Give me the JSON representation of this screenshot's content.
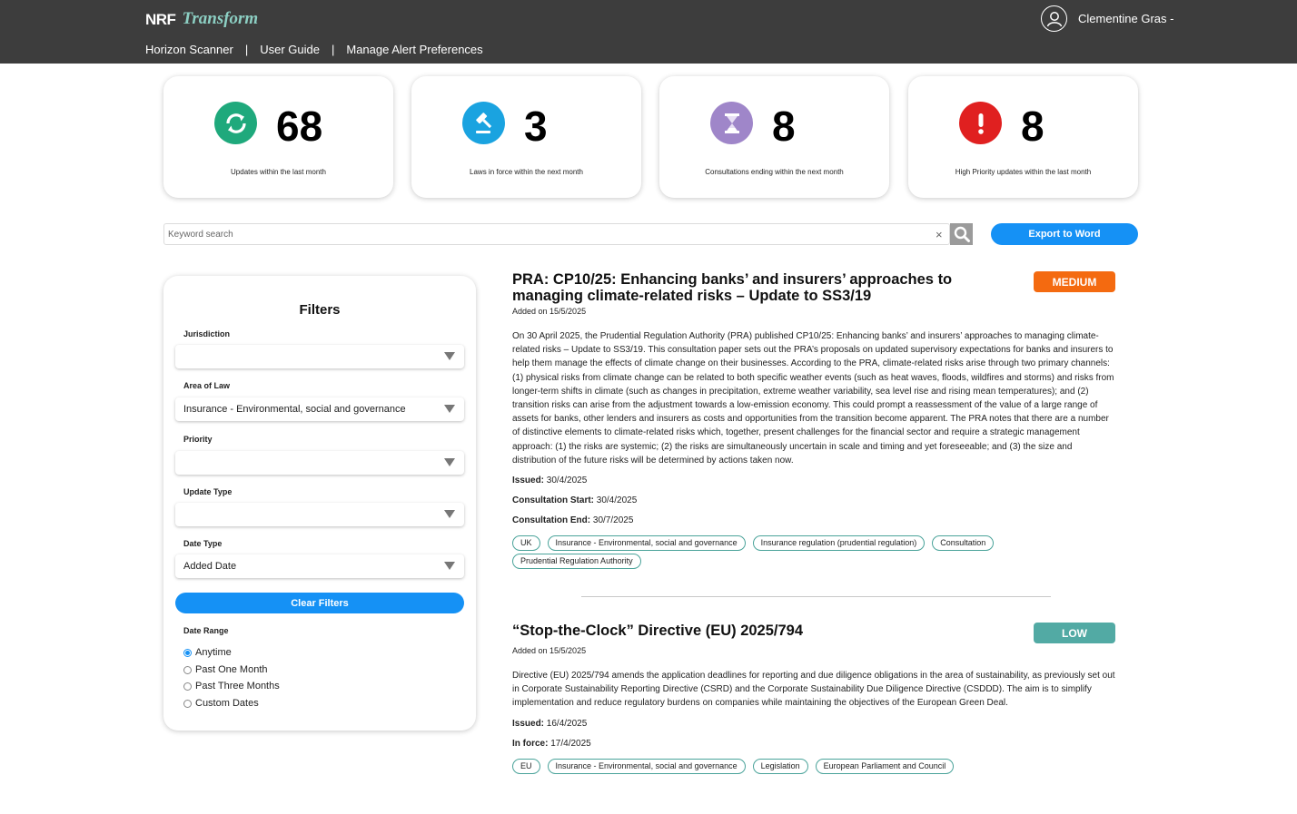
{
  "header": {
    "logo_nrf": "NRF",
    "logo_transform": "Transform",
    "nav": [
      "Horizon Scanner",
      "User Guide",
      "Manage Alert Preferences"
    ],
    "separator": "|",
    "user_name": "Clementine Gras -"
  },
  "stats": [
    {
      "value": "68",
      "caption": "Updates within the last month",
      "color": "#1fa97c",
      "icon": "refresh-icon"
    },
    {
      "value": "3",
      "caption": "Laws in force within the next month",
      "color": "#1aa3e0",
      "icon": "gavel-icon"
    },
    {
      "value": "8",
      "caption": "Consultations ending within the next month",
      "color": "#9f86c9",
      "icon": "hourglass-icon"
    },
    {
      "value": "8",
      "caption": "High Priority updates within the last month",
      "color": "#e02020",
      "icon": "alert-icon"
    }
  ],
  "search": {
    "placeholder": "Keyword search",
    "clear_symbol": "×",
    "export_label": "Export to Word"
  },
  "filters": {
    "title": "Filters",
    "jurisdiction_label": "Jurisdiction",
    "jurisdiction_value": "",
    "area_label": "Area of Law",
    "area_value": "Insurance - Environmental, social and governance",
    "priority_label": "Priority",
    "priority_value": "",
    "update_type_label": "Update Type",
    "update_type_value": "",
    "date_type_label": "Date Type",
    "date_type_value": "Added Date",
    "clear_label": "Clear Filters",
    "date_range_label": "Date Range",
    "date_range_options": [
      "Anytime",
      "Past One Month",
      "Past Three Months",
      "Custom Dates"
    ],
    "date_range_selected": "Anytime"
  },
  "articles": [
    {
      "title": "PRA: CP10/25: Enhancing banks’ and insurers’ approaches to managing climate-related risks – Update to SS3/19",
      "added": "Added on 15/5/2025",
      "priority": "MEDIUM",
      "priority_color": "#f46a10",
      "body": "On 30 April 2025, the Prudential Regulation Authority (PRA) published CP10/25: Enhancing banks’ and insurers’ approaches to managing climate-related risks – Update to SS3/19. This consultation paper sets out the PRA’s proposals on updated supervisory expectations for banks and insurers to help them manage the effects of climate change on their businesses. According to the PRA, climate-related risks arise through two primary channels: (1) physical risks from climate change can be related to both specific weather events (such as heat waves, floods, wildfires and storms) and risks from longer-term shifts in climate (such as changes in precipitation, extreme weather variability, sea level rise and rising mean temperatures); and (2) transition risks can arise from the adjustment towards a low-emission economy. This could prompt a reassessment of the value of a large range of assets for banks, other lenders and insurers as costs and opportunities from the transition become apparent. The PRA notes that there are a number of distinctive elements to climate-related risks which, together, present challenges for the financial sector and require a strategic management approach: (1) the risks are systemic; (2) the risks are simultaneously uncertain in scale and timing and yet foreseeable; and (3) the size and distribution of the future risks will be determined by actions taken now.",
      "meta": [
        {
          "label": "Issued:",
          "value": "30/4/2025"
        },
        {
          "label": "Consultation Start:",
          "value": "30/4/2025"
        },
        {
          "label": "Consultation End:",
          "value": "30/7/2025"
        }
      ],
      "tags": [
        "UK",
        "Insurance - Environmental, social and governance",
        "Insurance regulation (prudential regulation)",
        "Consultation",
        "Prudential Regulation Authority"
      ]
    },
    {
      "title": "“Stop-the-Clock” Directive (EU) 2025/794",
      "added": "Added on 15/5/2025",
      "priority": "LOW",
      "priority_color": "#52aaa4",
      "body": "Directive (EU) 2025/794 amends the application deadlines for reporting and due diligence obligations in the area of sustainability, as previously set out in Corporate Sustainability Reporting Directive (CSRD) and the Corporate Sustainability Due Diligence Directive (CSDDD). The aim is to simplify implementation and reduce regulatory burdens on companies while maintaining the objectives of the European Green Deal.",
      "meta": [
        {
          "label": "Issued:",
          "value": "16/4/2025"
        },
        {
          "label": "In force:",
          "value": "17/4/2025"
        }
      ],
      "tags": [
        "EU",
        "Insurance - Environmental, social and governance",
        "Legislation",
        "European Parliament and Council"
      ]
    }
  ]
}
